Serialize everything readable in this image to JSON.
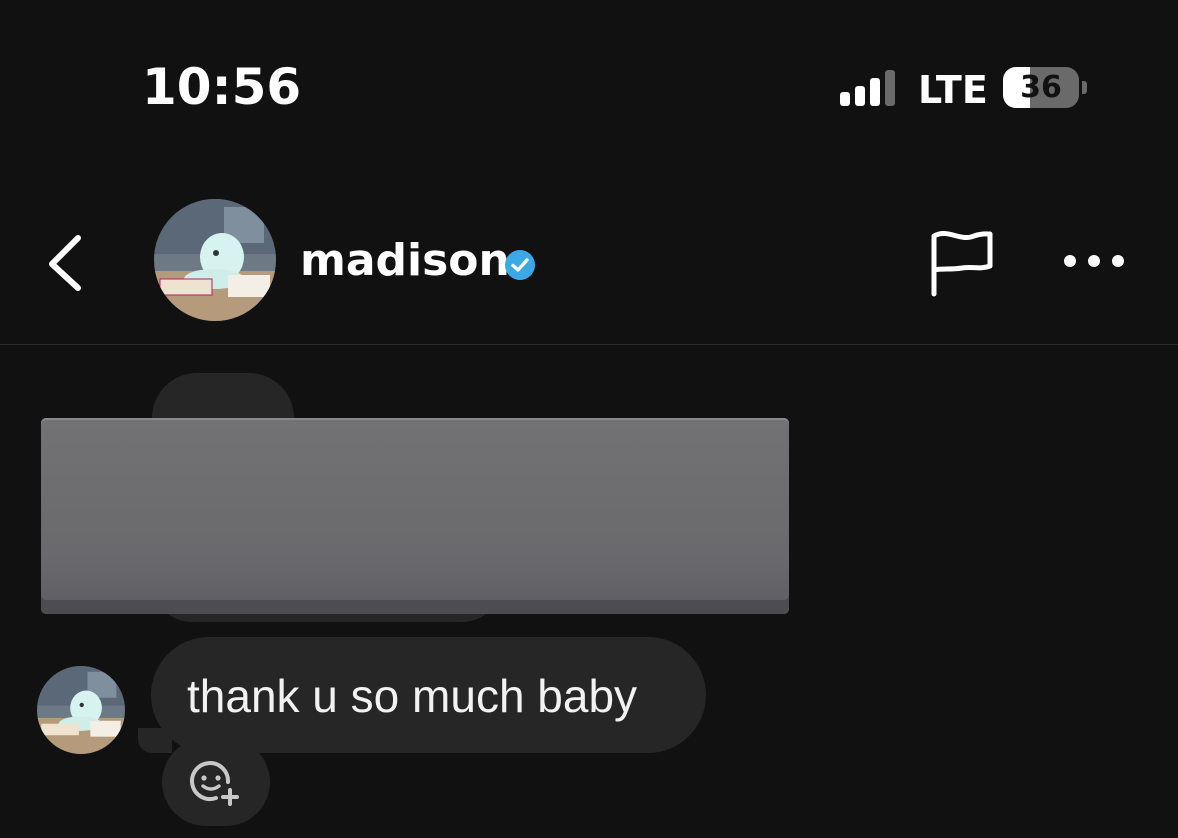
{
  "status_bar": {
    "time": "10:56",
    "network": "LTE",
    "battery_level": "36",
    "battery_fraction": 0.36,
    "signal_bars_active": 3
  },
  "header": {
    "back_icon": "chevron-left-icon",
    "username": "madison",
    "verified_icon": "verified-badge-icon",
    "flag_icon": "flag-icon",
    "more_icon": "more-horizontal-icon"
  },
  "messages": [
    {
      "sender": "madison",
      "partial_text": "...",
      "redacted": true
    },
    {
      "sender": "madison",
      "text": "thank u so much baby"
    }
  ],
  "reaction": {
    "icon": "add-reaction-icon"
  },
  "colors": {
    "background": "#111111",
    "bubble": "#262626",
    "verified": "#3aa9e6",
    "redaction": "#6c6c6f"
  }
}
